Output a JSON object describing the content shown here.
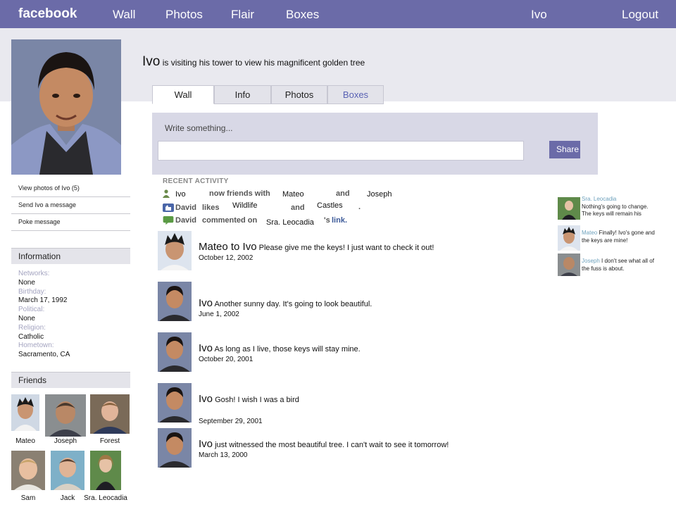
{
  "nav": {
    "logo": "facebook",
    "items": [
      "Wall",
      "Photos",
      "Flair",
      "Boxes"
    ],
    "user": "Ivo",
    "logout": "Logout"
  },
  "status": {
    "name": "Ivo",
    "text": "is visiting his tower to view his magnificent golden tree"
  },
  "tabs": [
    "Wall",
    "Info",
    "Photos",
    "Boxes"
  ],
  "composer": {
    "prompt": "Write something...",
    "share_label": "Share"
  },
  "left_links": [
    "View photos of Ivo (5)",
    "Send Ivo a message",
    "Poke message"
  ],
  "information": {
    "title": "Information",
    "fields": [
      {
        "label": "Networks:",
        "value": "None"
      },
      {
        "label": "Birthday:",
        "value": "March 17, 1992"
      },
      {
        "label": "Political:",
        "value": "None"
      },
      {
        "label": "Religion:",
        "value": "Catholic"
      },
      {
        "label": "Hometown:",
        "value": "Sacramento, CA"
      }
    ]
  },
  "friends": {
    "title": "Friends",
    "list": [
      "Mateo",
      "Joseph",
      "Forest",
      "Sam",
      "Jack",
      "Sra. Leocadia"
    ]
  },
  "recent_activity": {
    "title": "RECENT ACTIVITY",
    "line1": {
      "a": "Ivo",
      "verb": "now friends with",
      "b": "Mateo",
      "and": "and",
      "c": "Joseph"
    },
    "line2": {
      "actor": "David",
      "verb": "likes",
      "a": "Wildlife",
      "and": "and",
      "b": "Castles",
      "end": "."
    },
    "line3": {
      "actor": "David",
      "verb": "commented on",
      "target": "Sra. Leocadia",
      "possessive": "'s",
      "link": "link."
    }
  },
  "posts": [
    {
      "author": "Mateo to Ivo",
      "text": "Please give me the keys! I just want to check it out!",
      "date": "October 12, 2002"
    },
    {
      "author": "Ivo",
      "text": "Another sunny day. It's going to look beautiful.",
      "date": "June 1, 2002"
    },
    {
      "author": "Ivo",
      "text": "As long as I live, those keys will stay mine.",
      "date": "October 20, 2001"
    },
    {
      "author": "Ivo",
      "text": "Gosh! I wish I was a bird",
      "date": "September 29, 2001"
    },
    {
      "author": "Ivo",
      "text": "just witnessed the most beautiful tree. I can't wait to see it tomorrow!",
      "date": "March 13, 2000"
    }
  ],
  "sidebar_comments": [
    {
      "who": "Sra. Leocadia",
      "text": "Nothing's going to change. The keys will remain his"
    },
    {
      "who": "Mateo",
      "text": "Finally! Ivo's gone and the keys are mine!"
    },
    {
      "who": "Joseph",
      "text": "I don't see what all of the fuss is about."
    }
  ],
  "colors": {
    "topbar": "#6b6ba8",
    "band": "#e9e9ef",
    "composer": "#d8d8e6",
    "link_blue": "#3b5998",
    "muted_label": "#a4a4c0"
  }
}
